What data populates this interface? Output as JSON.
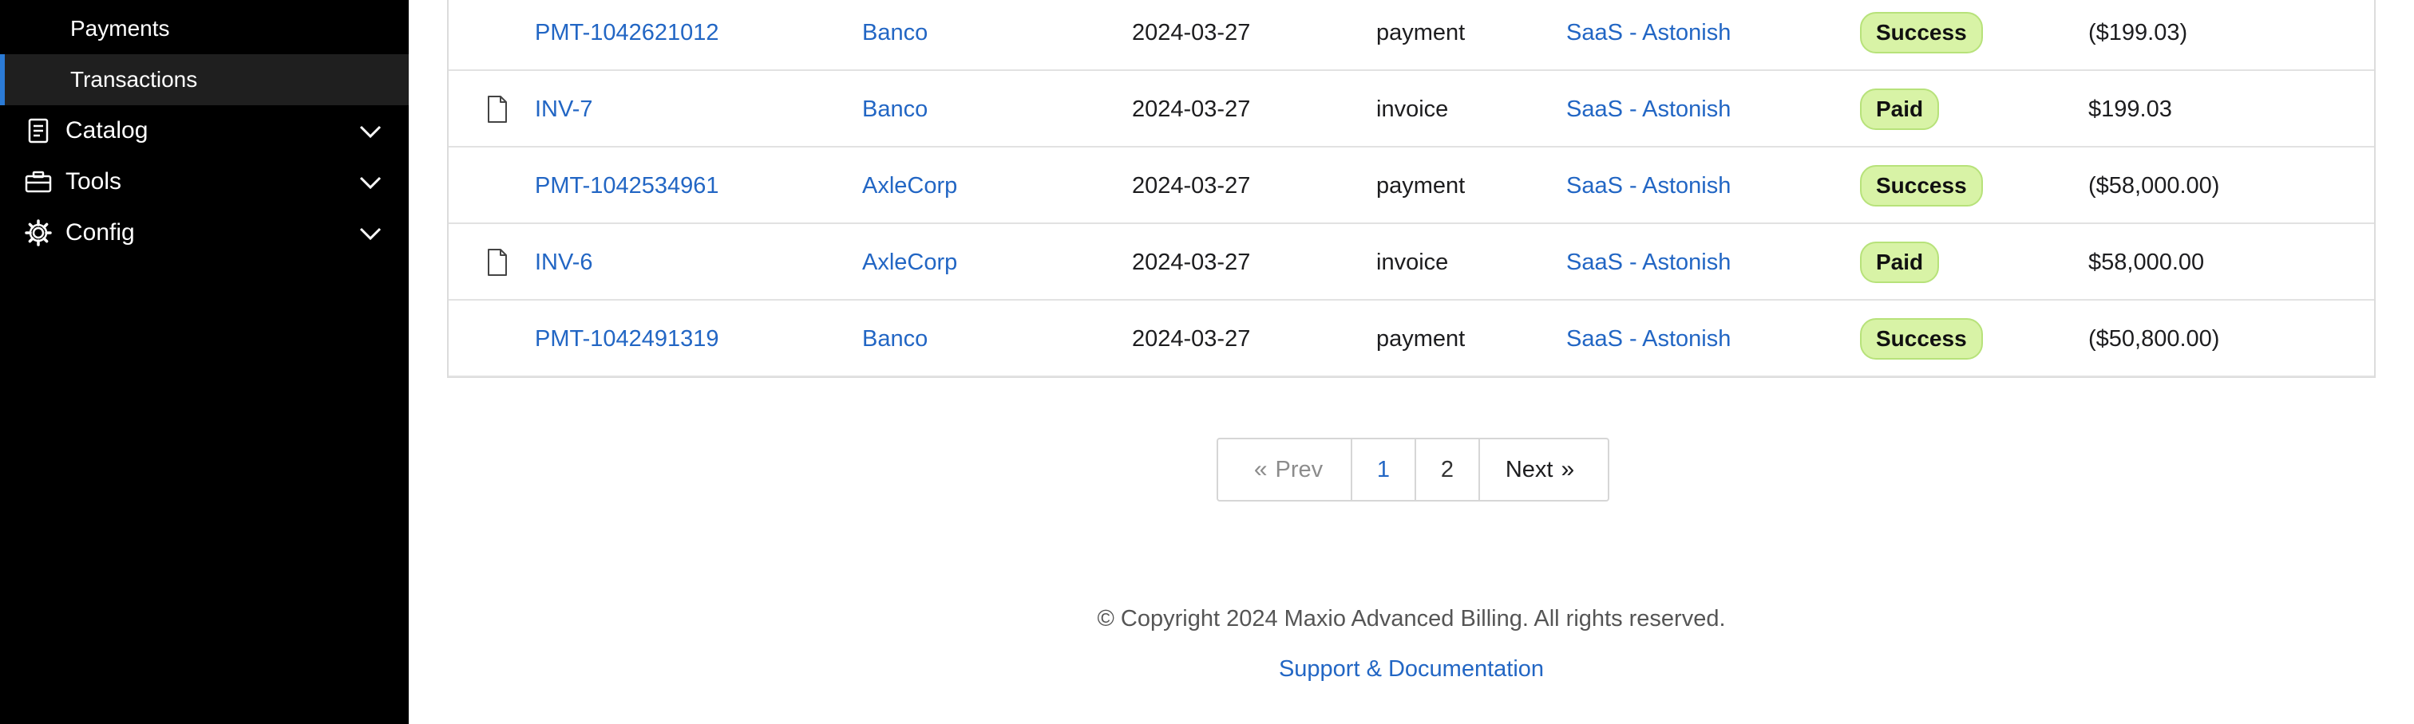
{
  "sidebar": {
    "subitems": [
      {
        "label": "Payments"
      },
      {
        "label": "Transactions"
      }
    ],
    "sections": [
      {
        "label": "Catalog",
        "icon": "receipt-icon"
      },
      {
        "label": "Tools",
        "icon": "briefcase-icon"
      },
      {
        "label": "Config",
        "icon": "gear-icon"
      }
    ]
  },
  "transactions": [
    {
      "id": "PMT-1042621012",
      "customer": "Banco",
      "date": "2024-03-27",
      "type": "payment",
      "site": "SaaS - Astonish",
      "status": "Success",
      "amount": "($199.03)",
      "has_doc_icon": false
    },
    {
      "id": "INV-7",
      "customer": "Banco",
      "date": "2024-03-27",
      "type": "invoice",
      "site": "SaaS - Astonish",
      "status": "Paid",
      "amount": "$199.03",
      "has_doc_icon": true
    },
    {
      "id": "PMT-1042534961",
      "customer": "AxleCorp",
      "date": "2024-03-27",
      "type": "payment",
      "site": "SaaS - Astonish",
      "status": "Success",
      "amount": "($58,000.00)",
      "has_doc_icon": false
    },
    {
      "id": "INV-6",
      "customer": "AxleCorp",
      "date": "2024-03-27",
      "type": "invoice",
      "site": "SaaS - Astonish",
      "status": "Paid",
      "amount": "$58,000.00",
      "has_doc_icon": true
    },
    {
      "id": "PMT-1042491319",
      "customer": "Banco",
      "date": "2024-03-27",
      "type": "payment",
      "site": "SaaS - Astonish",
      "status": "Success",
      "amount": "($50,800.00)",
      "has_doc_icon": false
    }
  ],
  "pagination": {
    "prev_label": "Prev",
    "pages": [
      "1",
      "2"
    ],
    "current_page": "1",
    "next_label": "Next"
  },
  "footer": {
    "copyright": "© Copyright 2024 Maxio Advanced Billing. All rights reserved.",
    "support_link": "Support & Documentation"
  },
  "colors": {
    "sidebar_bg": "#000000",
    "active_indicator": "#2b7bd6",
    "link": "#2266c4",
    "badge_bg": "#d8f3a6"
  }
}
